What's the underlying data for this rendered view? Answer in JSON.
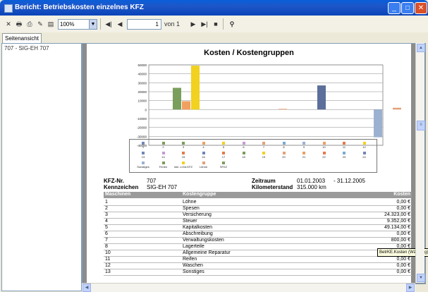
{
  "window": {
    "title": "Bericht: Betriebskosten einzelnes KFZ",
    "minimize": "_",
    "maximize": "□",
    "close": "✕"
  },
  "toolbar": {
    "zoom": "100%",
    "page_current": "1",
    "page_of": "von 1",
    "first": "◀|",
    "prev": "◀",
    "next": "▶",
    "last": "▶|",
    "stop": "■"
  },
  "tab": {
    "label": "Seitenansicht"
  },
  "tree": {
    "node": "707 - SIG-EH 707"
  },
  "report": {
    "title": "Kosten / Kostengruppen"
  },
  "chart_data": {
    "type": "bar",
    "title": "",
    "ylim": [
      -40000,
      50000
    ],
    "yticks": [
      "50000",
      "40000",
      "30000",
      "20000",
      "10000",
      "0",
      "-10000",
      "-20000",
      "-30000",
      "-40000"
    ],
    "series": [
      {
        "color": "#7a9e5b",
        "values": [
          24323
        ]
      },
      {
        "color": "#f0a060",
        "values": [
          9352
        ]
      },
      {
        "color": "#f2d11f",
        "values": [
          49134
        ]
      },
      {
        "color": "#e5a07a",
        "values": [
          800
        ]
      },
      {
        "color": "#5c6e9a",
        "values": [
          27000
        ]
      },
      {
        "color": "#9bb1d2",
        "values": [
          -31000
        ]
      },
      {
        "color": "#e5a07a",
        "values": [
          2000
        ]
      }
    ]
  },
  "legend": {
    "items": [
      {
        "label": "1",
        "color": "#7186b8"
      },
      {
        "label": "2",
        "color": "#7a9e5b"
      },
      {
        "label": "3",
        "color": "#7a9e5b"
      },
      {
        "label": "4",
        "color": "#f0a060"
      },
      {
        "label": "5",
        "color": "#f2d11f"
      },
      {
        "label": "6",
        "color": "#c69bd0"
      },
      {
        "label": "7",
        "color": "#e5a07a"
      },
      {
        "label": "8",
        "color": "#7ba9cf"
      },
      {
        "label": "9",
        "color": "#9bb1d2"
      },
      {
        "label": "10",
        "color": "#f0a060"
      },
      {
        "label": "11",
        "color": "#e57a4a"
      },
      {
        "label": "12",
        "color": "#f2d11f"
      },
      {
        "label": "13",
        "color": "#7186b8"
      },
      {
        "label": "14",
        "color": "#c69bd0"
      },
      {
        "label": "15",
        "color": "#e57a4a"
      },
      {
        "label": "16",
        "color": "#7186b8"
      },
      {
        "label": "17",
        "color": "#e57a4a"
      },
      {
        "label": "18",
        "color": "#7a9e5b"
      },
      {
        "label": "19",
        "color": "#f2d11f"
      },
      {
        "label": "20",
        "color": "#e5a07a"
      },
      {
        "label": "21",
        "color": "#f0a060"
      },
      {
        "label": "22",
        "color": "#e57a4a"
      },
      {
        "label": "23",
        "color": "#7ba9cf"
      },
      {
        "label": "24",
        "color": "#7186b8"
      },
      {
        "label": "Sonstiges",
        "color": "#9bb1d2"
      },
      {
        "label": "Ferien",
        "color": "#7a9e5b"
      },
      {
        "label": "inkl. o.Kst.KFZ",
        "color": "#f2d11f"
      },
      {
        "label": "Löhne",
        "color": "#e5a07a"
      },
      {
        "label": "SFKZ",
        "color": "#7a9e5b"
      }
    ]
  },
  "info": {
    "kfz_label": "KFZ-Nr.",
    "kfz_value": "707",
    "kennz_label": "Kennzeichen",
    "kennz_value": "SIG-EH 707",
    "zeitraum_label": "Zeitraum",
    "zeitraum_from": "01.01.2003",
    "zeitraum_to": "- 31.12.2005",
    "km_label": "Kilometerstand",
    "km_value": "315.000 km"
  },
  "table": {
    "headers": [
      "Maschinen",
      "Kostengruppe",
      "Kosten"
    ],
    "rows": [
      [
        "1",
        "Löhne",
        "0,00 €"
      ],
      [
        "2",
        "Spesen",
        "0,00 €"
      ],
      [
        "3",
        "Versicherung",
        "24.323,00 €"
      ],
      [
        "4",
        "Steuer",
        "9.352,00 €"
      ],
      [
        "5",
        "Kapitalkosten",
        "49.134,00 €"
      ],
      [
        "6",
        "Abschreibung",
        "0,00 €"
      ],
      [
        "7",
        "Verwaltungskosten",
        "800,00 €"
      ],
      [
        "8",
        "Lagerteile",
        "0,00 €"
      ],
      [
        "10",
        "Allgemeine Reparatur",
        "0,00 €"
      ],
      [
        "11",
        "Reifen",
        "0,00 €"
      ],
      [
        "12",
        "Waschen",
        "0,00 €"
      ],
      [
        "13",
        "Sonstiges",
        "0,00 €"
      ]
    ]
  },
  "tooltip": {
    "text": "BetrKE.Kosten (Währung)"
  }
}
